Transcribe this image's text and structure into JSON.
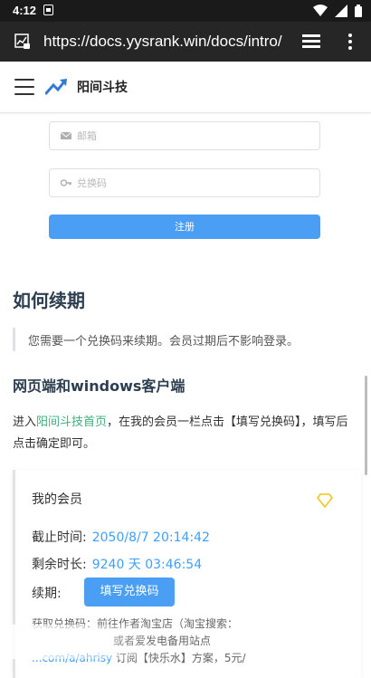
{
  "status_bar": {
    "time": "4:12",
    "icons": [
      "notification-icon",
      "wifi-icon",
      "signal-icon",
      "battery-icon"
    ]
  },
  "browser": {
    "url": "https://docs.yysrank.win/docs/intro/"
  },
  "header": {
    "brand": "阳间斗技"
  },
  "form": {
    "email_placeholder": "邮箱",
    "code_placeholder": "兑换码",
    "register_label": "注册"
  },
  "content": {
    "heading": "如何续期",
    "quote": "您需要一个兑换码来续期。会员过期后不影响登录。",
    "subheading": "网页端和windows客户端",
    "para_prefix": "进入",
    "para_link": "阳间斗技首页",
    "para_suffix": "，在我的会员一栏点击【填写兑换码】，填写后点击确定即可。"
  },
  "member_card": {
    "title": "我的会员",
    "expiry_label": "截止时间:",
    "expiry_value": "2050/8/7 20:14:42",
    "remaining_label": "剩余时长:",
    "remaining_value": "9240 天 03:46:54",
    "renew_label": "续期:",
    "renew_button": "填写兑换码",
    "hint_line1": "获取兑换码：前往作者淘宝店（淘宝搜索：",
    "hint_line2": "或者爱发电备用站点",
    "hint_line3_link": "...com/a/ahrisy",
    "hint_line3_text": " 订阅【快乐水】方案，5元/"
  },
  "colors": {
    "accent_blue": "#409eff",
    "button_blue": "#4a9ef3",
    "link_green": "#3eaf7c",
    "diamond_yellow": "#f5c518"
  }
}
